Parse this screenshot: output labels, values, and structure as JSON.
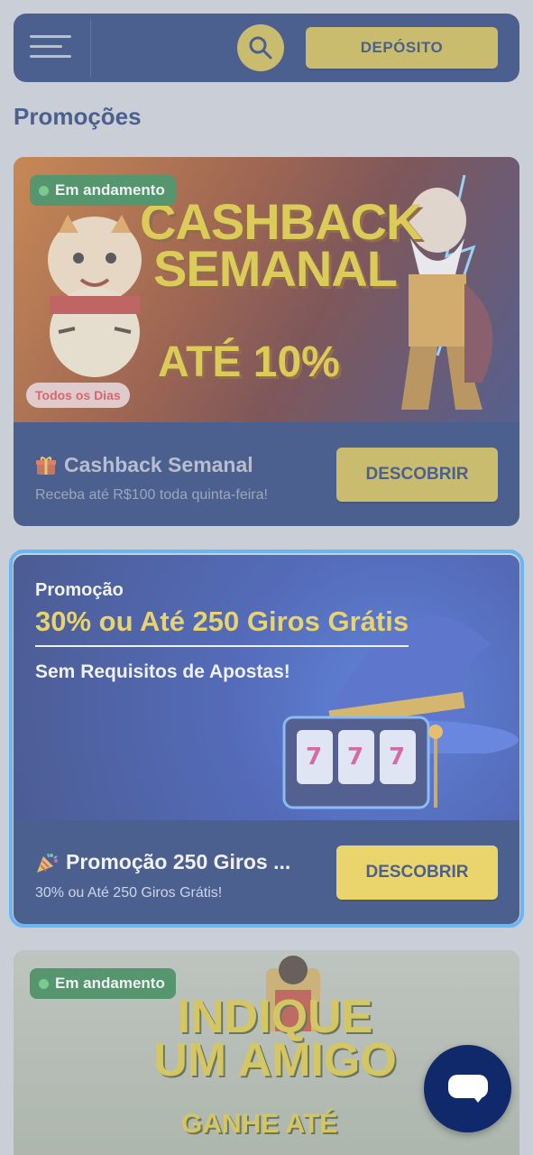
{
  "header": {
    "deposit_label": "DEPÓSITO"
  },
  "page_title": "Promoções",
  "promotions": [
    {
      "status_badge": "Em andamento",
      "banner_heading": "CASHBACK SEMANAL",
      "banner_highlight": "ATÉ 10%",
      "banner_tag": "Todos os Dias",
      "icon": "gift-icon",
      "title": "Cashback Semanal",
      "subtitle": "Receba até R$100 toda quinta-feira!",
      "button_label": "DESCOBRIR"
    },
    {
      "banner_label": "Promoção",
      "banner_heading": "30% ou Até 250 Giros Grátis",
      "banner_sub": "Sem Requisitos de Apostas!",
      "icon": "party-popper-icon",
      "title": "Promoção 250 Giros ...",
      "subtitle": "30% ou Até 250 Giros Grátis!",
      "button_label": "DESCOBRIR"
    },
    {
      "status_badge": "Em andamento",
      "banner_heading": "INDIQUE UM AMIGO",
      "banner_sub": "GANHE ATÉ"
    }
  ],
  "colors": {
    "navy": "#0f2a6b",
    "gold_button": "#f6d637",
    "highlight_border": "#3aa8ff",
    "badge_green": "#1d7a3a"
  }
}
